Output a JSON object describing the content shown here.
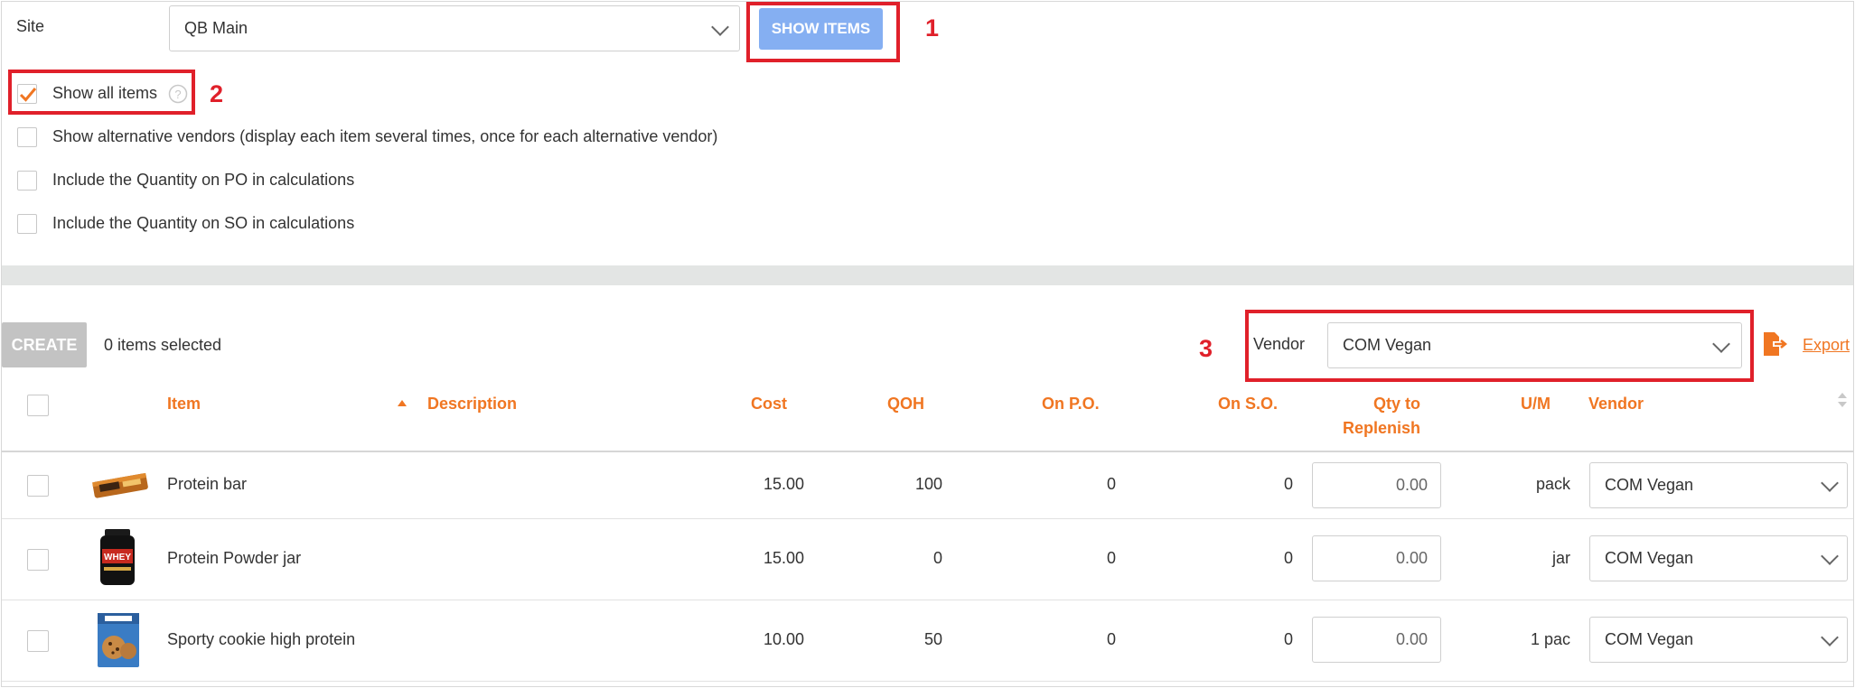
{
  "filters": {
    "site_label": "Site",
    "site_value": "QB Main",
    "show_items_label": "SHOW ITEMS",
    "checkboxes": [
      {
        "label": "Show all items",
        "checked": true
      },
      {
        "label": "Show alternative vendors (display each item several times, once for each alternative vendor)",
        "checked": false
      },
      {
        "label": "Include the Quantity on PO in calculations",
        "checked": false
      },
      {
        "label": "Include the Quantity on SO in calculations",
        "checked": false
      }
    ],
    "help_icon": "question-circle-icon"
  },
  "annotations": [
    "1",
    "2",
    "3"
  ],
  "toolbar": {
    "create_label": "CREATE",
    "selected_count": "0 items selected",
    "vendor_label": "Vendor",
    "vendor_value": "COM Vegan",
    "export_label": "Export",
    "export_icon": "file-export-icon"
  },
  "table": {
    "headers": {
      "item": "Item",
      "description": "Description",
      "cost": "Cost",
      "qoh": "QOH",
      "on_po": "On P.O.",
      "on_so": "On S.O.",
      "qty_to_replenish_1": "Qty to",
      "qty_to_replenish_2": "Replenish",
      "um": "U/M",
      "vendor": "Vendor"
    },
    "rows": [
      {
        "item": "Protein bar",
        "cost": "15.00",
        "qoh": "100",
        "on_po": "0",
        "on_so": "0",
        "qty": "0.00",
        "um": "pack",
        "vendor": "COM Vegan",
        "image": "protein-bar-image"
      },
      {
        "item": "Protein Powder jar",
        "cost": "15.00",
        "qoh": "0",
        "on_po": "0",
        "on_so": "0",
        "qty": "0.00",
        "um": "jar",
        "vendor": "COM Vegan",
        "image": "protein-powder-jar-image"
      },
      {
        "item": "Sporty cookie high protein",
        "cost": "10.00",
        "qoh": "50",
        "on_po": "0",
        "on_so": "0",
        "qty": "0.00",
        "um": "1 pac",
        "vendor": "COM Vegan",
        "image": "cookie-box-image"
      }
    ]
  },
  "colors": {
    "accent": "#f07622",
    "button": "#85aff2",
    "highlight": "#e0202a",
    "disabled": "#c3c3c3"
  }
}
